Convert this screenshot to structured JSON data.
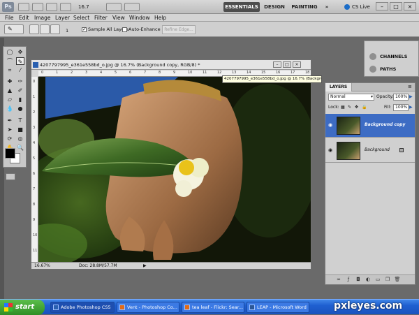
{
  "app": {
    "logo": "Ps",
    "zoom": "16.7",
    "workspaces": [
      "ESSENTIALS",
      "DESIGN",
      "PAINTING"
    ],
    "more": "»",
    "cs_live": "CS Live",
    "win_controls": [
      "–",
      "□",
      "×"
    ]
  },
  "menu": [
    "File",
    "Edit",
    "Image",
    "Layer",
    "Select",
    "Filter",
    "View",
    "Window",
    "Help"
  ],
  "options": {
    "brush_size": "1",
    "sample_all_layers": "Sample All Layers",
    "auto_enhance": "Auto-Enhance",
    "refine_edge": "Refine Edge..."
  },
  "document": {
    "title": "4207797995_e361e558bd_o.jpg @ 16.7% (Background copy, RGB/8) *",
    "tooltip": "4207797995_e361e558bd_o.jpg @ 16.7% (Background copy, RGB/8) *",
    "ruler_h": [
      "0",
      "1",
      "2",
      "3",
      "4",
      "5",
      "6",
      "7",
      "8",
      "9",
      "10",
      "11",
      "12",
      "13",
      "14",
      "15",
      "16",
      "17",
      "18"
    ],
    "ruler_v": [
      "0",
      "1",
      "2",
      "3",
      "4",
      "5",
      "6",
      "7",
      "8",
      "9",
      "10",
      "11"
    ],
    "zoom_status": "16.67%",
    "doc_status": "Doc: 28.8M/57.7M"
  },
  "dock": {
    "channels": "CHANNELS",
    "paths": "PATHS"
  },
  "layers_panel": {
    "tab": "LAYERS",
    "blend_mode": "Normal",
    "opacity_label": "Opacity:",
    "opacity_value": "100%",
    "lock_label": "Lock:",
    "fill_label": "Fill:",
    "fill_value": "100%",
    "layers": [
      {
        "name": "Background copy"
      },
      {
        "name": "Background"
      }
    ]
  },
  "taskbar": {
    "start": "start",
    "tasks": [
      "Adobe Photoshop CS5",
      "Vent - Photoshop Co...",
      "tea leaf - Flickr: Sear...",
      "LEAP - Microsoft Word"
    ],
    "watermark": "pxleyes.com"
  },
  "colors": {
    "selection": "#3d6cc4",
    "taskbar": "#1f5fd0",
    "start": "#2f8f25"
  }
}
